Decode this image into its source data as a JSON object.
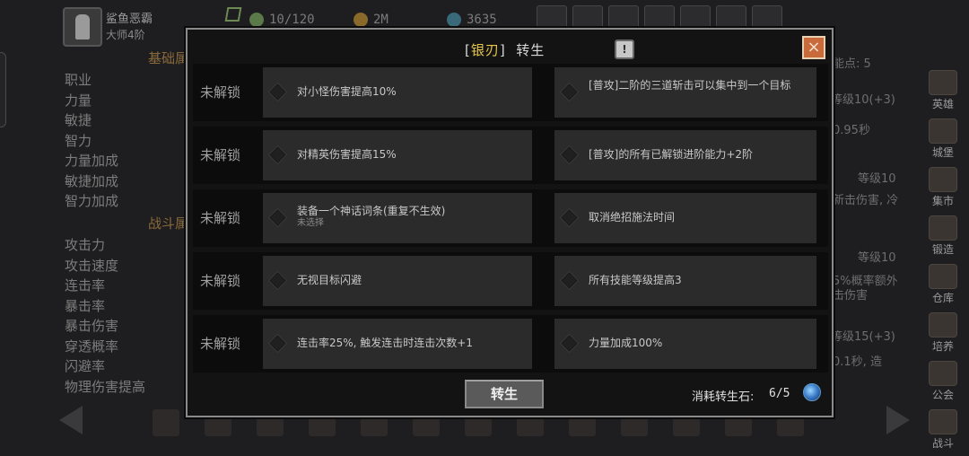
{
  "background": {
    "player": {
      "name": "鲨鱼恶霸",
      "rank": "大师4阶"
    },
    "resources": {
      "energy": "10/120",
      "gold": "2M",
      "gems": "3635"
    },
    "section_basic": "基础属",
    "section_battle": "战斗属",
    "stats_basic": [
      "职业",
      "力量",
      "敏捷",
      "智力",
      "力量加成",
      "敏捷加成",
      "智力加成"
    ],
    "stats_battle": [
      "攻击力",
      "攻击速度",
      "连击率",
      "暴击率",
      "暴击伤害",
      "穿透概率",
      "闪避率",
      "物理伤害提高"
    ],
    "right_fragments": {
      "skill_points": "能点: 5",
      "level10a": "等级10(+3)",
      "sec095": "0.95秒",
      "level10b": "等级10",
      "extra_dmg": "新击伤害, 冷",
      "level10c": "等级10",
      "chance": "5%概率额外",
      "hit_dmg": "击伤害",
      "level15": "等级15(+3)",
      "sec01": "0.1秒, 造"
    },
    "side_nav": [
      "英雄",
      "城堡",
      "集市",
      "锻造",
      "仓库",
      "培养",
      "公会",
      "战斗"
    ]
  },
  "modal": {
    "title_bracket_open": "[",
    "title_name": "银刃",
    "title_bracket_close": "]",
    "title_action": "转生",
    "info_icon": "!",
    "close_icon": "×",
    "rows": [
      {
        "label": "未解锁",
        "left": "对小怪伤害提高10%",
        "right": "[普攻]二阶的三道斩击可以集中到一个目标"
      },
      {
        "label": "未解锁",
        "left": "对精英伤害提高15%",
        "right": "[普攻]的所有已解锁进阶能力+2阶"
      },
      {
        "label": "未解锁",
        "left": "装备一个神话词条(重复不生效)",
        "left_sub": "未选择",
        "right": "取消绝招施法时间"
      },
      {
        "label": "未解锁",
        "left": "无视目标闪避",
        "right": "所有技能等级提高3"
      },
      {
        "label": "未解锁",
        "left": "连击率25%, 触发连击时连击次数+1",
        "right": "力量加成100%"
      }
    ],
    "rebirth_button": "转生",
    "cost_label": "消耗转生石:",
    "cost_value": "6/5"
  }
}
